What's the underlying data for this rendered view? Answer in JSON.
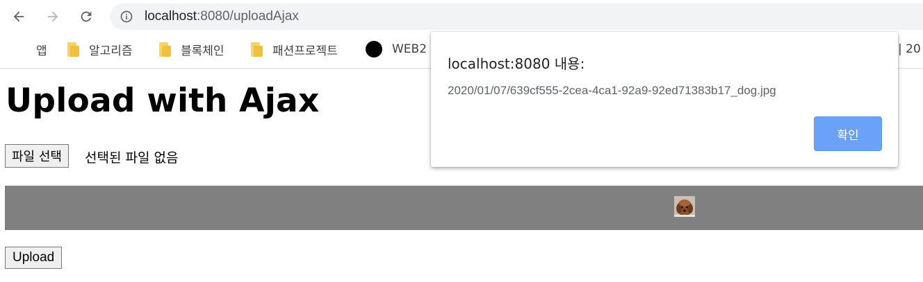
{
  "browser": {
    "url_host": "localhost",
    "url_path": ":8080/uploadAjax"
  },
  "bookmarks": {
    "items": [
      {
        "label": "앱",
        "icon": "apps-grid-icon"
      },
      {
        "label": "알고리즘",
        "icon": "folder-icon"
      },
      {
        "label": "블록체인",
        "icon": "folder-icon"
      },
      {
        "label": "패션프로젝트",
        "icon": "folder-icon"
      },
      {
        "label": "WEB2 -",
        "icon": "black-circle-icon"
      }
    ],
    "overflow_text": "| 20"
  },
  "page": {
    "title": "Upload with Ajax",
    "file_button_label": "파일 선택",
    "file_status": "선택된 파일 없음",
    "upload_button_label": "Upload",
    "thumbnail_icon": "dog-thumbnail-image"
  },
  "dialog": {
    "title": "localhost:8080 내용:",
    "message": "2020/01/07/639cf555-2cea-4ca1-92a9-92ed71383b17_dog.jpg",
    "ok_label": "확인",
    "accent": "#6aa1f9"
  }
}
